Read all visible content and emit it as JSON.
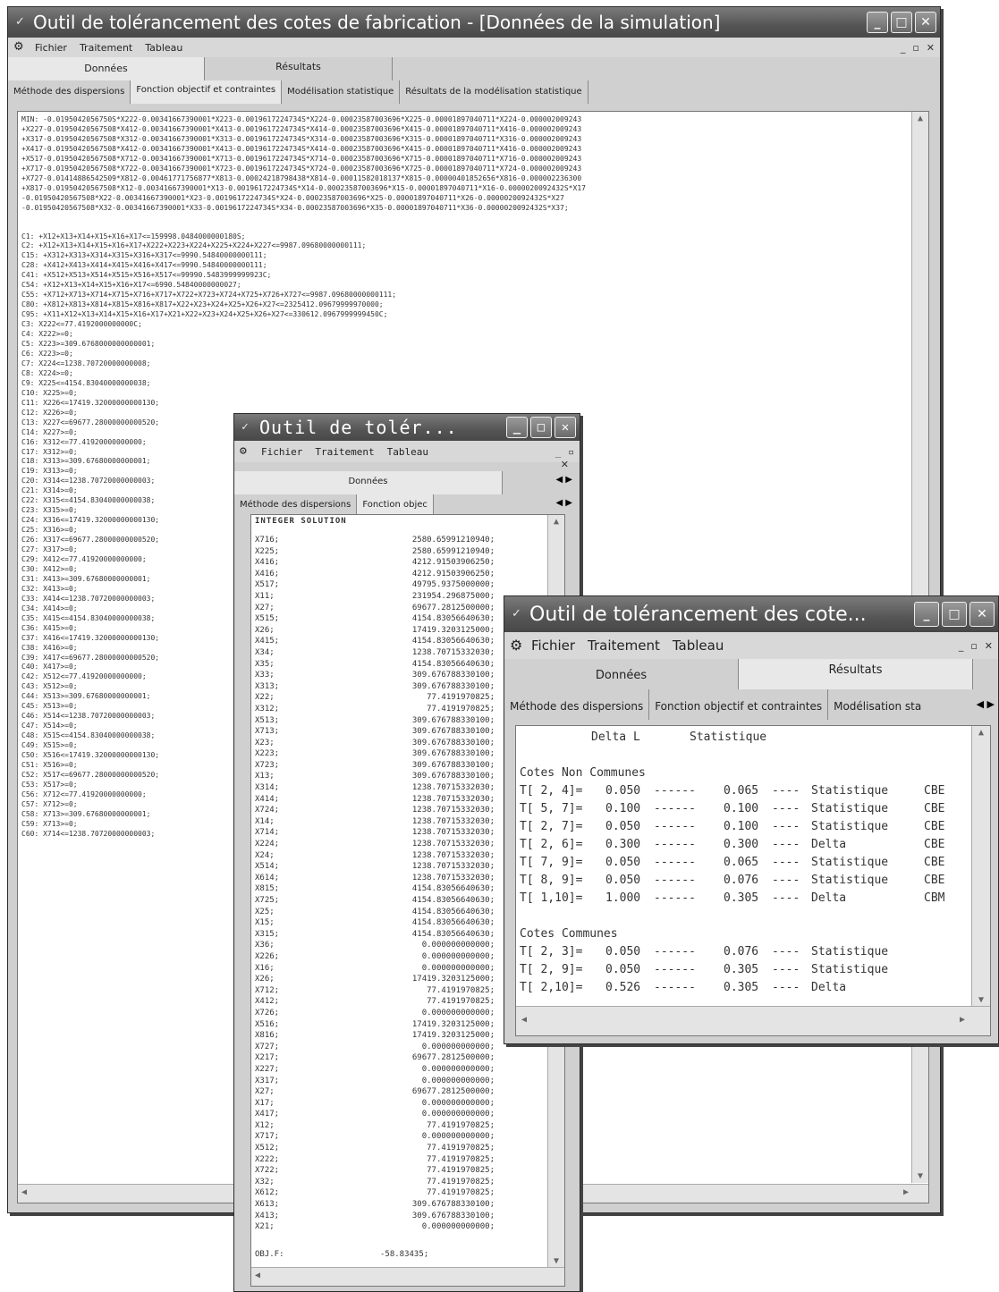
{
  "win1": {
    "title": "Outil de tolérancement des cotes de fabrication - [Données de la simulation]",
    "menu": [
      "Fichier",
      "Traitement",
      "Tableau"
    ],
    "main_tabs": [
      "Données",
      "Résultats"
    ],
    "sub_tabs": [
      "Méthode des dispersions",
      "Fonction objectif et contraintes",
      "Modélisation statistique",
      "Résultats de la modélisation statistique"
    ],
    "objective_lines": [
      "MIN: -0.0195042056750S*X222-0.00341667390001*X223-0.0019617224734S*X224-0.00023587003696*X225-0.00001897040711*X224-0.000002009243",
      "+X227-0.01950420567508*X412-0.00341667390001*X413-0.0019617224734S*X414-0.00023587003696*X415-0.00001897040711*X416-0.000002009243",
      "+X317-0.01950420567508*X312-0.00341667390001*X313-0.0019617224734S*X314-0.00023587003696*X315-0.00001897040711*X316-0.000002009243",
      "+X417-0.01950420567508*X412-0.00341667390001*X413-0.0019617224734S*X414-0.00023587003696*X415-0.00001897040711*X416-0.000002009243",
      "+X517-0.01950420567508*X712-0.00341667390001*X713-0.0019617224734S*X714-0.00023587003696*X715-0.00001897040711*X716-0.000002009243",
      "+X717-0.01950420567508*X722-0.00341667390001*X723-0.0019617224734S*X724-0.00023587003696*X725-0.00001897040711*X724-0.000002009243",
      "+X727-0.01414886542509*X812-0.00461771756877*X813-0.00024218798438*X814-0.00011582018137*X815-0.00000401852656*X816-0.000002236300",
      "+X817-0.01950420567508*X12-0.00341667390001*X13-0.0019617224734S*X14-0.00023587003696*X15-0.00001897040711*X16-0.0000020092432S*X17",
      "-0.01950420567508*X22-0.00341667390001*X23-0.0019617224734S*X24-0.00023587003696*X25-0.00001897040711*X26-0.0000020092432S*X27",
      "-0.01950420567508*X32-0.00341667390001*X33-0.0019617224734S*X34-0.00023587003696*X35-0.00001897040711*X36-0.0000020092432S*X37;"
    ],
    "constraint_lines": [
      "C1: +X12+X13+X14+X15+X16+X17<=159998.0484000000180S;",
      "C2: +X12+X13+X14+X15+X16+X17+X222+X223+X224+X225+X224+X227<=9987.09680000000111;",
      "C15: +X312+X313+X314+X315+X316+X317<=9990.54840000000111;",
      "C28: +X412+X413+X414+X415+X416+X417<=9990.54840000000111;",
      "C41: +X512+X513+X514+X515+X516+X517<=99990.5483999999923C;",
      "C54: +X12+X13+X14+X15+X16+X17<=6990.54840000000027;",
      "C55: +X712+X713+X714+X715+X716+X717+X722+X723+X724+X725+X726+X727<=9987.09680000000111;",
      "C80: +X812+X813+X814+X815+X816+X817+X22+X23+X24+X25+X26+X27<=2325412.09679999970000;",
      "C95: +X11+X12+X13+X14+X15+X16+X17+X21+X22+X23+X24+X25+X26+X27<=330612.0967999999450C;",
      "C3: X222<=77.4192000000000C;",
      "C4: X222>=0;",
      "C5: X223>=309.6768000000000001;",
      "C6: X223>=0;",
      "C7: X224<=1238.70720000000008;",
      "C8: X224>=0;",
      "C9: X225<=4154.83040000000038;",
      "C10: X225>=0;",
      "C11: X226<=17419.32000000000130;",
      "C12: X226>=0;",
      "C13: X227<=69677.28000000000520;",
      "C14: X227>=0;",
      "C16: X312<=77.41920000000000;",
      "C17: X312>=0;",
      "C18: X313>=309.67680000000001;",
      "C19: X313>=0;",
      "C20: X314<=1238.70720000000003;",
      "C21: X314>=0;",
      "C22: X315<=4154.83040000000038;",
      "C23: X315>=0;",
      "C24: X316<=17419.32000000000130;",
      "C25: X316>=0;",
      "C26: X317<=69677.28000000000520;",
      "C27: X317>=0;",
      "C29: X412<=77.41920000000000;",
      "C30: X412>=0;",
      "C31: X413>=309.67680000000001;",
      "C32: X413>=0;",
      "C33: X414<=1238.70720000000003;",
      "C34: X414>=0;",
      "C35: X415<=4154.83040000000038;",
      "C36: X415>=0;",
      "C37: X416<=17419.32000000000130;",
      "C38: X416>=0;",
      "C39: X417<=69677.28000000000520;",
      "C40: X417>=0;",
      "C42: X512<=77.41920000000000;",
      "C43: X512>=0;",
      "C44: X513>=309.67680000000001;",
      "C45: X513>=0;",
      "C46: X514<=1238.70720000000003;",
      "C47: X514>=0;",
      "C48: X515<=4154.83040000000038;",
      "C49: X515>=0;",
      "C50: X516<=17419.32000000000130;",
      "C51: X516>=0;",
      "C52: X517<=69677.28000000000520;",
      "C53: X517>=0;",
      "C56: X712<=77.41920000000000;",
      "C57: X712>=0;",
      "C58: X713>=309.67680000000001;",
      "C59: X713>=0;",
      "C60: X714<=1238.70720000000003;"
    ]
  },
  "win2": {
    "title": "Outil de tolér...",
    "menu": [
      "Fichier",
      "Traitement",
      "Tableau"
    ],
    "main_tab": "Données",
    "sub_tabs": [
      "Méthode des dispersions",
      "Fonction objec"
    ],
    "header": "INTEGER SOLUTION",
    "rows": [
      [
        "X716;",
        "2580.65991210940;"
      ],
      [
        "X225;",
        "2580.65991210940;"
      ],
      [
        "X416;",
        "4212.91503906250;"
      ],
      [
        "X416;",
        "4212.91503906250;"
      ],
      [
        "X517;",
        "49795.9375000000;"
      ],
      [
        "X11;",
        "231954.296875000;"
      ],
      [
        "X27;",
        "69677.2812500000;"
      ],
      [
        "X515;",
        "4154.83056640630;"
      ],
      [
        "X26;",
        "17419.3203125000;"
      ],
      [
        "X415;",
        "4154.83056640630;"
      ],
      [
        "X34;",
        "1238.70715332030;"
      ],
      [
        "X35;",
        "4154.83056640630;"
      ],
      [
        "X33;",
        "309.676788330100;"
      ],
      [
        "X313;",
        "309.676788330100;"
      ],
      [
        "X22;",
        "77.4191970825;"
      ],
      [
        "X312;",
        "77.4191970825;"
      ],
      [
        "X513;",
        "309.676788330100;"
      ],
      [
        "X713;",
        "309.676788330100;"
      ],
      [
        "X23;",
        "309.676788330100;"
      ],
      [
        "X223;",
        "309.676788330100;"
      ],
      [
        "X723;",
        "309.676788330100;"
      ],
      [
        "X13;",
        "309.676788330100;"
      ],
      [
        "X314;",
        "1238.70715332030;"
      ],
      [
        "X414;",
        "1238.70715332030;"
      ],
      [
        "X724;",
        "1238.70715332030;"
      ],
      [
        "X14;",
        "1238.70715332030;"
      ],
      [
        "X714;",
        "1238.70715332030;"
      ],
      [
        "X224;",
        "1238.70715332030;"
      ],
      [
        "X24;",
        "1238.70715332030;"
      ],
      [
        "X514;",
        "1238.70715332030;"
      ],
      [
        "X614;",
        "1238.70715332030;"
      ],
      [
        "X815;",
        "4154.83056640630;"
      ],
      [
        "X725;",
        "4154.83056640630;"
      ],
      [
        "X25;",
        "4154.83056640630;"
      ],
      [
        "X15;",
        "4154.83056640630;"
      ],
      [
        "X315;",
        "4154.83056640630;"
      ],
      [
        "X36;",
        "0.000000000000;"
      ],
      [
        "X226;",
        "0.000000000000;"
      ],
      [
        "X16;",
        "0.000000000000;"
      ],
      [
        "X26;",
        "17419.3203125000;"
      ],
      [
        "X712;",
        "77.4191970825;"
      ],
      [
        "X412;",
        "77.4191970825;"
      ],
      [
        "X726;",
        "0.000000000000;"
      ],
      [
        "X516;",
        "17419.3203125000;"
      ],
      [
        "X816;",
        "17419.3203125000;"
      ],
      [
        "X727;",
        "0.000000000000;"
      ],
      [
        "X217;",
        "69677.2812500000;"
      ],
      [
        "X227;",
        "0.000000000000;"
      ],
      [
        "X317;",
        "0.000000000000;"
      ],
      [
        "X27;",
        "69677.2812500000;"
      ],
      [
        "X17;",
        "0.000000000000;"
      ],
      [
        "X417;",
        "0.000000000000;"
      ],
      [
        "X12;",
        "77.4191970825;"
      ],
      [
        "X717;",
        "0.000000000000;"
      ],
      [
        "X512;",
        "77.4191970825;"
      ],
      [
        "X222;",
        "77.4191970825;"
      ],
      [
        "X722;",
        "77.4191970825;"
      ],
      [
        "X32;",
        "77.4191970825;"
      ],
      [
        "X612;",
        "77.4191970825;"
      ],
      [
        "X613;",
        "309.676788330100;"
      ],
      [
        "X413;",
        "309.676788330100;"
      ],
      [
        "X21;",
        "0.000000000000;"
      ]
    ],
    "footer_label": "OBJ.F:",
    "footer_value": "-58.83435;"
  },
  "win3": {
    "title": "Outil de tolérancement des cote...",
    "menu": [
      "Fichier",
      "Traitement",
      "Tableau"
    ],
    "main_tabs": [
      "Données",
      "Résultats"
    ],
    "sub_tabs": [
      "Méthode des dispersions",
      "Fonction objectif et contraintes",
      "Modélisation sta"
    ],
    "col_header_1": "Delta L",
    "col_header_2": "Statistique",
    "section1": "Cotes Non Communes",
    "rows1": [
      {
        "id": "T[ 2, 4]=",
        "v1": "0.050",
        "sep1": "------",
        "v2": "0.065",
        "sep2": "----",
        "m": "Statistique",
        "c": "CBE"
      },
      {
        "id": "T[ 5, 7]=",
        "v1": "0.100",
        "sep1": "------",
        "v2": "0.100",
        "sep2": "----",
        "m": "Statistique",
        "c": "CBE"
      },
      {
        "id": "T[ 2, 7]=",
        "v1": "0.050",
        "sep1": "------",
        "v2": "0.100",
        "sep2": "----",
        "m": "Statistique",
        "c": "CBE"
      },
      {
        "id": "T[ 2, 6]=",
        "v1": "0.300",
        "sep1": "------",
        "v2": "0.300",
        "sep2": "----",
        "m": "Delta",
        "c": "CBE"
      },
      {
        "id": "T[ 7, 9]=",
        "v1": "0.050",
        "sep1": "------",
        "v2": "0.065",
        "sep2": "----",
        "m": "Statistique",
        "c": "CBE"
      },
      {
        "id": "T[ 8, 9]=",
        "v1": "0.050",
        "sep1": "------",
        "v2": "0.076",
        "sep2": "----",
        "m": "Statistique",
        "c": "CBE"
      },
      {
        "id": "T[ 1,10]=",
        "v1": "1.000",
        "sep1": "------",
        "v2": "0.305",
        "sep2": "----",
        "m": "Delta",
        "c": "CBM"
      }
    ],
    "section2": "Cotes Communes",
    "rows2": [
      {
        "id": "T[ 2, 3]=",
        "v1": "0.050",
        "sep1": "------",
        "v2": "0.076",
        "sep2": "----",
        "m": "Statistique"
      },
      {
        "id": "T[ 2, 9]=",
        "v1": "0.050",
        "sep1": "------",
        "v2": "0.305",
        "sep2": "----",
        "m": "Statistique"
      },
      {
        "id": "T[ 2,10]=",
        "v1": "0.526",
        "sep1": "------",
        "v2": "0.305",
        "sep2": "----",
        "m": "Delta"
      }
    ]
  }
}
